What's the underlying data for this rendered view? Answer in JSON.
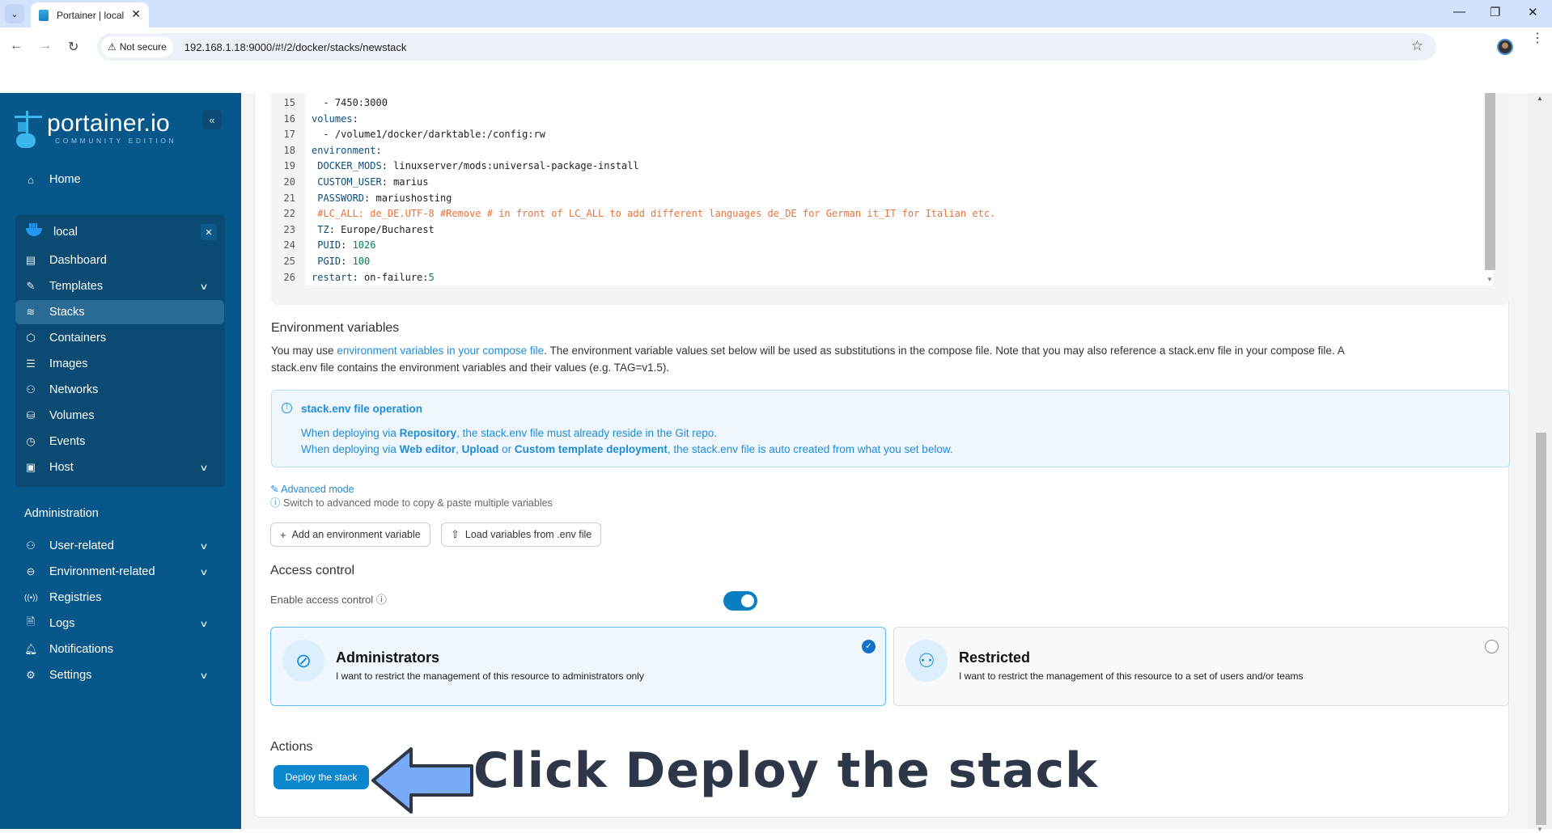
{
  "browser": {
    "tab_title": "Portainer | local",
    "security_label": "Not secure",
    "url": "192.168.1.18:9000/#!/2/docker/stacks/newstack"
  },
  "sidebar": {
    "brand": "portainer.io",
    "edition": "COMMUNITY EDITION",
    "home": "Home",
    "environment": "local",
    "env_items": [
      {
        "label": "Dashboard",
        "icon": "layout-icon"
      },
      {
        "label": "Templates",
        "icon": "edit-icon",
        "expandable": true
      },
      {
        "label": "Stacks",
        "icon": "layers-icon",
        "active": true
      },
      {
        "label": "Containers",
        "icon": "box-icon"
      },
      {
        "label": "Images",
        "icon": "list-icon"
      },
      {
        "label": "Networks",
        "icon": "network-icon"
      },
      {
        "label": "Volumes",
        "icon": "database-icon"
      },
      {
        "label": "Events",
        "icon": "clock-icon"
      },
      {
        "label": "Host",
        "icon": "server-icon",
        "expandable": true
      }
    ],
    "admin_heading": "Administration",
    "admin_items": [
      {
        "label": "User-related",
        "icon": "users-icon",
        "expandable": true
      },
      {
        "label": "Environment-related",
        "icon": "hard-drive-icon",
        "expandable": true
      },
      {
        "label": "Registries",
        "icon": "radio-icon"
      },
      {
        "label": "Logs",
        "icon": "file-icon",
        "expandable": true
      },
      {
        "label": "Notifications",
        "icon": "bell-icon"
      },
      {
        "label": "Settings",
        "icon": "gear-icon",
        "expandable": true
      }
    ]
  },
  "editor": {
    "lines": [
      {
        "n": "15",
        "text": "  - 7450:3000"
      },
      {
        "n": "16",
        "key": "volumes",
        "text": ":"
      },
      {
        "n": "17",
        "text": "  - /volume1/docker/darktable:/config:rw"
      },
      {
        "n": "18",
        "key": "environment",
        "text": ":"
      },
      {
        "n": "19",
        "key": " DOCKER_MODS",
        "text": ": linuxserver/mods:universal-package-install"
      },
      {
        "n": "20",
        "key": " CUSTOM_USER",
        "text": ": marius"
      },
      {
        "n": "21",
        "key": " PASSWORD",
        "text": ": mariushosting"
      },
      {
        "n": "22",
        "comment": " #LC_ALL: de_DE.UTF-8 #Remove # in front of LC_ALL to add different languages de_DE for German it_IT for Italian etc."
      },
      {
        "n": "23",
        "key": " TZ",
        "text": ": Europe/Bucharest"
      },
      {
        "n": "24",
        "key": " PUID",
        "text": ": ",
        "num": "1026"
      },
      {
        "n": "25",
        "key": " PGID",
        "text": ": ",
        "num": "100"
      },
      {
        "n": "26",
        "key": "restart",
        "text": ": on-failure:",
        "num": "5"
      }
    ]
  },
  "env_vars": {
    "heading": "Environment variables",
    "p_before": "You may use ",
    "p_link": "environment variables in your compose file",
    "p_after": ". The environment variable values set below will be used as substitutions in the compose file. Note that you may also reference a stack.env file in your compose file. A",
    "p_line2": "stack.env file contains the environment variables and their values (e.g. TAG=v1.5).",
    "info_title": "stack.env file operation",
    "info_l1_a": "When deploying via ",
    "info_l1_b": "Repository",
    "info_l1_c": ", the stack.env file must already reside in the Git repo.",
    "info_l2_a": "When deploying via ",
    "info_l2_b": "Web editor",
    "info_l2_c": ", ",
    "info_l2_d": "Upload",
    "info_l2_e": " or ",
    "info_l2_f": "Custom template deployment",
    "info_l2_g": ", the stack.env file is auto created from what you set below.",
    "advanced_mode": "Advanced mode",
    "advanced_hint": "Switch to advanced mode to copy & paste multiple variables",
    "add_button": "Add an environment variable",
    "load_button": "Load variables from .env file"
  },
  "access": {
    "heading": "Access control",
    "enable_label": "Enable access control",
    "enabled": true,
    "options": [
      {
        "title": "Administrators",
        "desc": "I want to restrict the management of this resource to administrators only",
        "selected": true
      },
      {
        "title": "Restricted",
        "desc": "I want to restrict the management of this resource to a set of users and/or teams",
        "selected": false
      }
    ]
  },
  "actions": {
    "heading": "Actions",
    "deploy_button": "Deploy the stack"
  },
  "annotation": "Click Deploy the stack",
  "colors": {
    "sidebar": "#08578a",
    "accent": "#0b86cf",
    "annotation_arrow": "#79aaf7"
  }
}
